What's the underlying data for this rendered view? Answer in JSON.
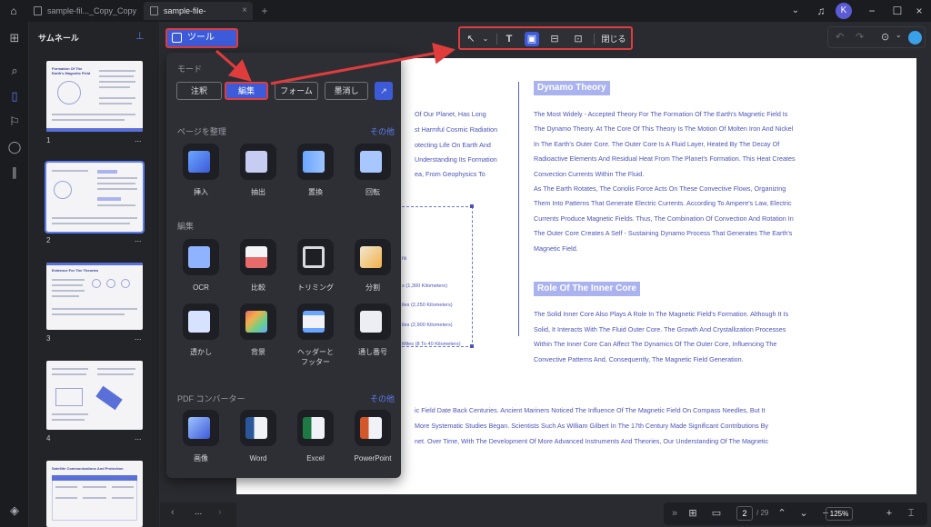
{
  "titlebar": {
    "tabs": [
      {
        "label": "sample-fil..._Copy_Copy"
      },
      {
        "label": "sample-file-editable_OCR"
      }
    ],
    "new_tab": "+",
    "avatar_letter": "K"
  },
  "sidebar": {
    "title": "サムネール",
    "pages": [
      {
        "number": "1",
        "title": "Formation Of The Earth's Magnetic Field"
      },
      {
        "number": "2",
        "title": ""
      },
      {
        "number": "3",
        "title": "Evidence For The Theories"
      },
      {
        "number": "4",
        "title": ""
      },
      {
        "number": "5",
        "title": "Satellite Communications And Protection"
      }
    ],
    "more": "..."
  },
  "tools_button": {
    "label": "ツール"
  },
  "toolbar": {
    "close_label": "閉じる"
  },
  "panel": {
    "mode_heading": "モード",
    "modes": [
      {
        "label": "注釈"
      },
      {
        "label": "編集"
      },
      {
        "label": "フォーム"
      },
      {
        "label": "墨消し"
      }
    ],
    "organize_heading": "ページを整理",
    "organize_more": "その他",
    "organize_tools": [
      {
        "label": "挿入"
      },
      {
        "label": "抽出"
      },
      {
        "label": "置換"
      },
      {
        "label": "回転"
      }
    ],
    "edit_heading": "編集",
    "edit_tools": [
      {
        "label": "OCR"
      },
      {
        "label": "比較"
      },
      {
        "label": "トリミング"
      },
      {
        "label": "分割"
      },
      {
        "label": "透かし"
      },
      {
        "label": "背景"
      },
      {
        "label": "ヘッダーと\nフッター"
      },
      {
        "label": "通し番号"
      }
    ],
    "converter_heading": "PDF コンバーター",
    "converter_more": "その他",
    "converter_tools": [
      {
        "label": "画像"
      },
      {
        "label": "Word"
      },
      {
        "label": "Excel"
      },
      {
        "label": "PowerPoint"
      }
    ]
  },
  "document": {
    "left_lines": [
      "Of Our Planet, Has Long",
      "st Harmful Cosmic Radiation",
      "otecting Life On Earth And",
      "Understanding Its Formation",
      "ea, From Geophysics To"
    ],
    "diagram_labels": [
      "re",
      "s (1,300 Kilometers)",
      "iles (2,250 Kilometers)",
      "iles (2,900 Kilometers)",
      "Miles (8 To 40 Kilometers)"
    ],
    "dynamo_heading": "Dynamo Theory",
    "dynamo_lines": [
      "The Most Widely - Accepted Theory For The Formation Of The Earth's Magnetic Field Is",
      "The Dynamo Theory. At The Core Of This Theory Is The Motion Of Molten Iron And Nickel",
      "In The Earth's Outer Core. The Outer Core Is A Fluid Layer, Heated By The Decay Of",
      "Radioactive Elements And Residual Heat From The Planet's Formation. This Heat Creates",
      "Convection Currents Within The Fluid.",
      "As The Earth Rotates, The Coriolis Force Acts On These Convective Flows, Organizing",
      "Them Into Patterns That Generate Electric Currents. According To Ampere's Law, Electric",
      "Currents Produce Magnetic Fields. Thus, The Combination Of Convection And Rotation In",
      "The Outer Core Creates A Self - Sustaining Dynamo Process That Generates The Earth's",
      "Magnetic Field."
    ],
    "inner_heading": "Role Of The Inner Core",
    "inner_lines": [
      "The Solid Inner Core Also Plays A Role In The Magnetic Field's Formation. Although It Is",
      "Solid, It Interacts With The Fluid Outer Core. The Growth And Crystallization Processes",
      "Within The Inner Core Can Affect The Dynamics Of The Outer Core, Influencing The",
      "Convective Patterns And, Consequently, The Magnetic Field Generation."
    ],
    "bottom_lines": [
      "ic Field Date Back Centuries. Ancient Mariners Noticed The Influence Of The Magnetic Field On Compass Needles, But It",
      "More Systematic Studies Began. Scientists Such As William Gilbert In The 17th Century Made Significant Contributions By",
      "net. Over Time, With The Development Of More Advanced Instruments And Theories, Our Understanding Of The Magnetic"
    ]
  },
  "pagebar": {
    "current_page": "2",
    "total_pages": "/ 29",
    "zoom": "125%"
  },
  "colors": {
    "accent": "#3d5ad8",
    "highlight_border": "#e03c3c",
    "doc_text": "#4b53b8"
  }
}
